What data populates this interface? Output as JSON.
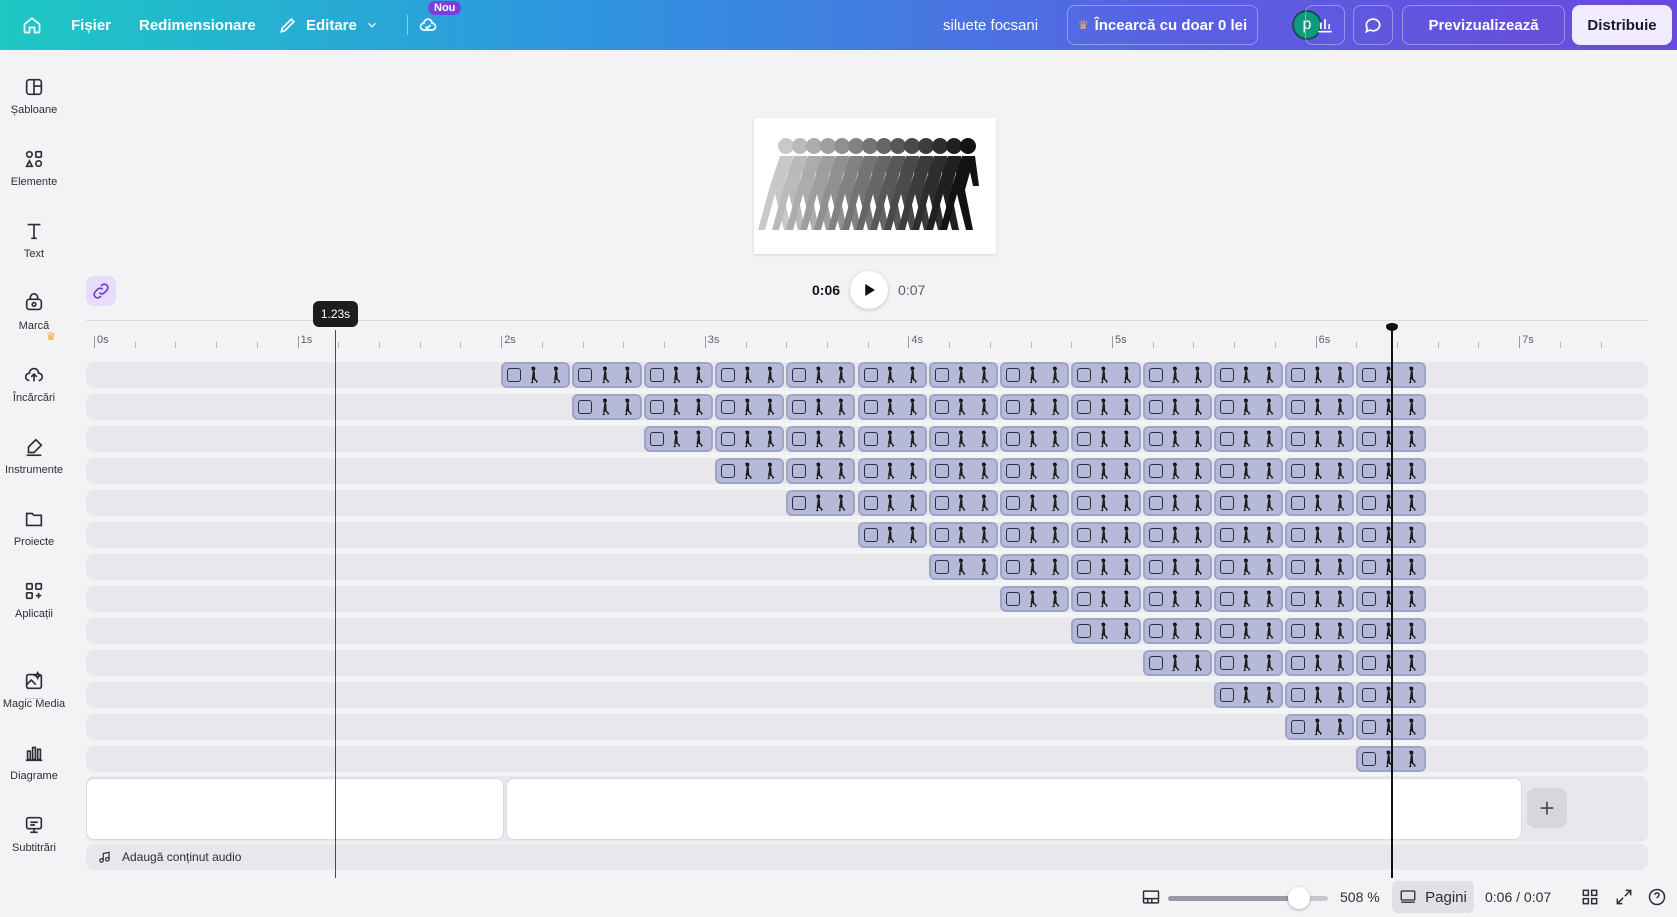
{
  "topbar": {
    "file": "Fișier",
    "resize": "Redimensionare",
    "edit": "Editare",
    "new_badge": "Nou",
    "project_name": "siluete focsani",
    "try_pro": "Încearcă cu doar 0 lei",
    "avatar_letter": "p",
    "preview": "Previzualizează",
    "share": "Distribuie"
  },
  "sidebar": {
    "items": [
      {
        "label": "Șabloane"
      },
      {
        "label": "Elemente"
      },
      {
        "label": "Text"
      },
      {
        "label": "Marcă"
      },
      {
        "label": "Încărcări"
      },
      {
        "label": "Instrumente"
      },
      {
        "label": "Proiecte"
      },
      {
        "label": "Aplicații"
      },
      {
        "label": "Magic Media"
      },
      {
        "label": "Diagrame"
      },
      {
        "label": "Subtitrări"
      }
    ]
  },
  "player": {
    "current": "0:06",
    "total": "0:07"
  },
  "timeline": {
    "ruler_labels": [
      "0s",
      "1s",
      "2s",
      "3s",
      "4s",
      "5s",
      "6s",
      "7s"
    ],
    "hover_time": "1.23s",
    "tracks": [
      {
        "start": 2.0
      },
      {
        "start": 2.35
      },
      {
        "start": 2.7
      },
      {
        "start": 3.05
      },
      {
        "start": 3.4
      },
      {
        "start": 3.75
      },
      {
        "start": 4.1
      },
      {
        "start": 4.45
      },
      {
        "start": 4.8
      },
      {
        "start": 5.15
      },
      {
        "start": 5.5
      },
      {
        "start": 5.85
      },
      {
        "start": 6.2
      }
    ],
    "track_end": 6.55,
    "clip_length": 0.35,
    "playhead": 6.37,
    "add_audio": "Adaugă conținut audio"
  },
  "bottombar": {
    "zoom": "508 %",
    "zoom_fraction": 0.82,
    "pages": "Pagini",
    "time": "0:06 / 0:07"
  },
  "colors": {
    "clip_fill": "#b6bad8",
    "clip_border": "#9ea3c8",
    "accent_purple": "#7b3fe0"
  }
}
